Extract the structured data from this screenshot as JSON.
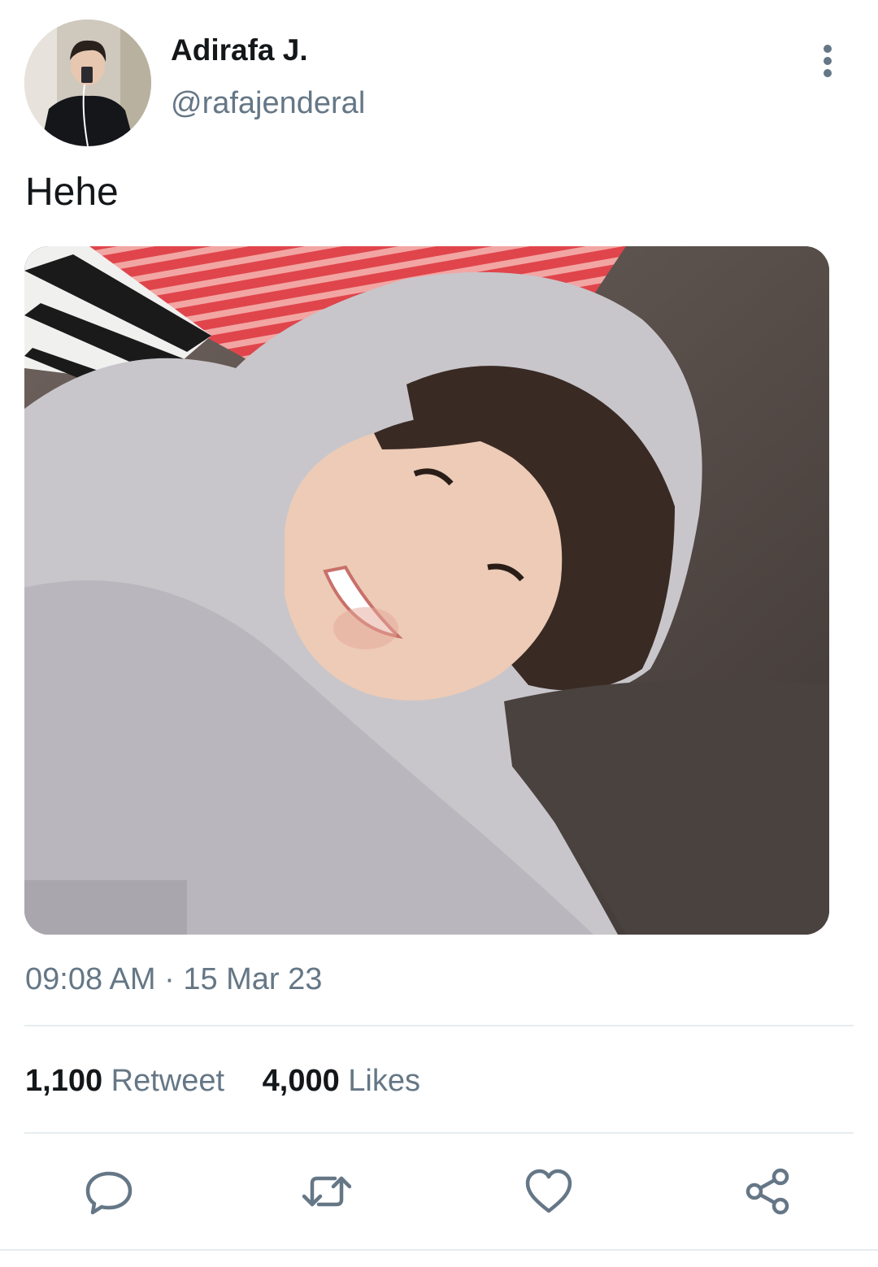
{
  "tweet": {
    "display_name": "Adirafa J.",
    "handle": "@rafajenderal",
    "text": "Hehe",
    "timestamp": "09:08 AM · 15 Mar 23",
    "media": {
      "kind": "photo"
    }
  },
  "stats": {
    "retweet_count": "1,100",
    "retweet_label": "Retweet",
    "likes_count": "4,000",
    "likes_label": "Likes"
  },
  "actions": [
    {
      "icon": "reply-icon"
    },
    {
      "icon": "retweet-icon"
    },
    {
      "icon": "heart-icon"
    },
    {
      "icon": "share-icon"
    }
  ],
  "colors": {
    "primary_text": "#14171a",
    "secondary_text": "#657786",
    "icon": "#657786",
    "divider": "#e6ecf0"
  }
}
